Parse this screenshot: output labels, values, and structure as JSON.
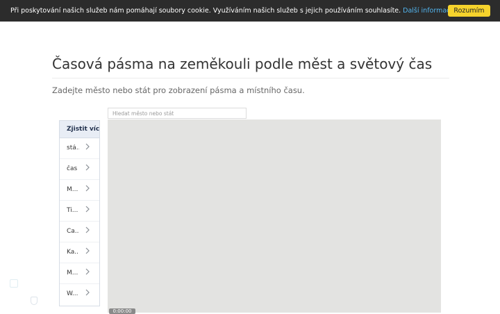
{
  "cookie_bar": {
    "text": "Při poskytování našich služeb nám pomáhají soubory cookie. Využíváním našich služeb s jejich používáním souhlasíte.",
    "link_label": "Další informace",
    "accept_label": "Rozumím"
  },
  "page": {
    "title": "Časová pásma na zeměkouli podle měst a světový čas",
    "intro": "Zadejte město nebo stát pro zobrazení pásma a místního času."
  },
  "map": {
    "search_placeholder": "Hledat město nebo stát",
    "search_value": "",
    "time_label": "0:00:00"
  },
  "side_panel": {
    "header": "Zjistit více",
    "items": [
      {
        "label": "stá..."
      },
      {
        "label": "čas"
      },
      {
        "label": "M..."
      },
      {
        "label": "Ti..."
      },
      {
        "label": "Ča..."
      },
      {
        "label": "Ka..."
      },
      {
        "label": "M..."
      },
      {
        "label": "W..."
      }
    ]
  },
  "colors": {
    "cookie_bar_bg": "#2c2c2c",
    "cookie_accept_bg": "#f6d32c",
    "cookie_link": "#53b6f0",
    "map_bg": "#e3e3e1",
    "panel_header_bg": "#e8edf5"
  },
  "icons": {
    "side_item": "chevron-right-icon"
  }
}
